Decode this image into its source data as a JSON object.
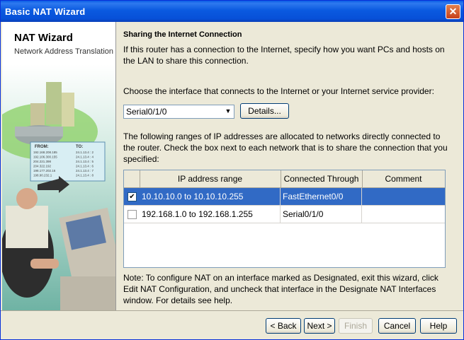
{
  "window": {
    "title": "Basic NAT Wizard"
  },
  "sidebar": {
    "title": "NAT Wizard",
    "subtitle": "Network Address Translation"
  },
  "content": {
    "heading": "Sharing the Internet Connection",
    "intro": "If this router has a connection to the Internet, specify how you want PCs and hosts on the LAN to share this connection.",
    "choose_prompt": "Choose the interface that connects to the Internet or your Internet service provider:",
    "interface_select": "Serial0/1/0",
    "details_label": "Details...",
    "ranges_text": "The following ranges of IP addresses are allocated to networks directly connected to the router. Check the box next to each network that is to share the connection that you specified:",
    "table": {
      "headers": [
        "IP address range",
        "Connected Through",
        "Comment"
      ],
      "rows": [
        {
          "checked": true,
          "range": "10.10.10.0 to 10.10.10.255",
          "through": "FastEthernet0/0",
          "comment": ""
        },
        {
          "checked": false,
          "range": "192.168.1.0 to 192.168.1.255",
          "through": "Serial0/1/0",
          "comment": ""
        }
      ]
    },
    "note": "Note: To configure NAT on an interface marked as Designated, exit this wizard, click Edit NAT Configuration, and uncheck that interface in the Designate NAT Interfaces window. For details see help."
  },
  "footer": {
    "back": "< Back",
    "next": "Next >",
    "finish": "Finish",
    "cancel": "Cancel",
    "help": "Help"
  },
  "illustration": {
    "table_header": [
      "FROM:",
      "TO:"
    ],
    "table_rows": [
      [
        "192.168.208.185",
        "24.1.13.4 : 2"
      ],
      [
        "192.106.300.155",
        "24.1.13.4 : 4"
      ],
      [
        "204.221.398",
        "24.1.13.4 : 5"
      ],
      [
        "204.322.192",
        "24.1.13.4 : 6"
      ],
      [
        "198.177.202.16",
        "24.1.13.4 : 7"
      ],
      [
        "198.90.232.1",
        "24.1.13.4 : 8"
      ]
    ]
  }
}
